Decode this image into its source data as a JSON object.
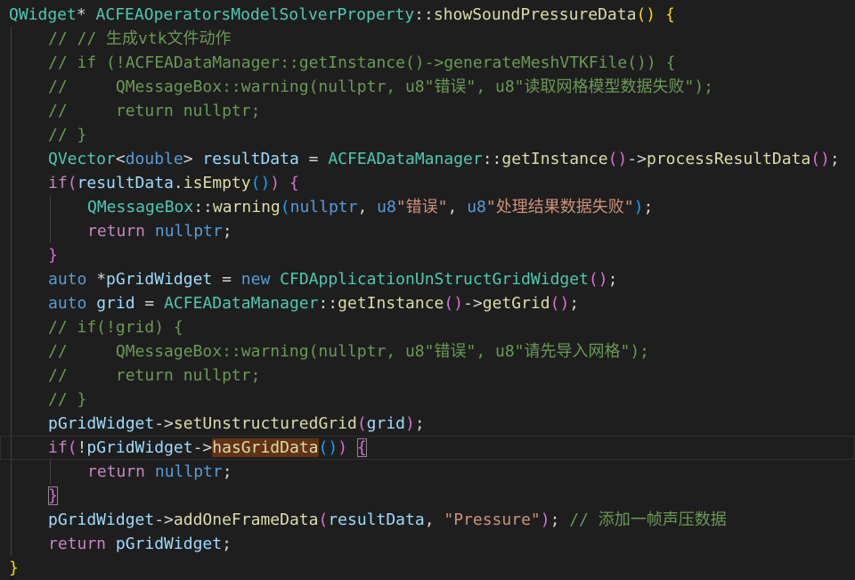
{
  "editor": {
    "lines": [
      {
        "indent": 0,
        "tokens": [
          [
            "QWidget",
            "t-type"
          ],
          [
            "* ",
            "t-default"
          ],
          [
            "ACFEAOperatorsModelSolverProperty",
            "t-type"
          ],
          [
            "::",
            "t-default"
          ],
          [
            "showSoundPressureData",
            "t-func"
          ],
          [
            "()",
            "t-b1"
          ],
          [
            " ",
            "t-default"
          ],
          [
            "{",
            "t-b1"
          ]
        ]
      },
      {
        "indent": 1,
        "tokens": [
          [
            "// // 生成vtk文件动作",
            "t-comment"
          ]
        ]
      },
      {
        "indent": 1,
        "tokens": [
          [
            "// if (!ACFEADataManager::getInstance()->generateMeshVTKFile()) {",
            "t-comment"
          ]
        ]
      },
      {
        "indent": 1,
        "tokens": [
          [
            "//     QMessageBox::warning(nullptr, u8\"错误\", u8\"读取网格模型数据失败\");",
            "t-comment"
          ]
        ]
      },
      {
        "indent": 1,
        "tokens": [
          [
            "//     return nullptr;",
            "t-comment"
          ]
        ]
      },
      {
        "indent": 1,
        "tokens": [
          [
            "// }",
            "t-comment"
          ]
        ]
      },
      {
        "indent": 1,
        "tokens": [
          [
            "QVector",
            "t-type"
          ],
          [
            "<",
            "t-default"
          ],
          [
            "double",
            "t-keyword"
          ],
          [
            "> ",
            "t-default"
          ],
          [
            "resultData",
            "t-var"
          ],
          [
            " = ",
            "t-default"
          ],
          [
            "ACFEADataManager",
            "t-type"
          ],
          [
            "::",
            "t-default"
          ],
          [
            "getInstance",
            "t-func"
          ],
          [
            "()",
            "t-b2"
          ],
          [
            "->",
            "t-default"
          ],
          [
            "processResultData",
            "t-func"
          ],
          [
            "()",
            "t-b2"
          ],
          [
            ";",
            "t-default"
          ]
        ]
      },
      {
        "indent": 1,
        "tokens": [
          [
            "if",
            "t-control"
          ],
          [
            "(",
            "t-b2"
          ],
          [
            "resultData",
            "t-var"
          ],
          [
            ".",
            "t-default"
          ],
          [
            "isEmpty",
            "t-func"
          ],
          [
            "()",
            "t-b3"
          ],
          [
            ")",
            "t-b2"
          ],
          [
            " ",
            "t-default"
          ],
          [
            "{",
            "t-b2"
          ]
        ]
      },
      {
        "indent": 2,
        "tokens": [
          [
            "QMessageBox",
            "t-type"
          ],
          [
            "::",
            "t-default"
          ],
          [
            "warning",
            "t-func"
          ],
          [
            "(",
            "t-b3"
          ],
          [
            "nullptr",
            "t-keyword"
          ],
          [
            ", ",
            "t-default"
          ],
          [
            "u8",
            "t-keyword"
          ],
          [
            "\"错误\"",
            "t-string"
          ],
          [
            ", ",
            "t-default"
          ],
          [
            "u8",
            "t-keyword"
          ],
          [
            "\"处理结果数据失败\"",
            "t-string"
          ],
          [
            ")",
            "t-b3"
          ],
          [
            ";",
            "t-default"
          ]
        ]
      },
      {
        "indent": 2,
        "tokens": [
          [
            "return",
            "t-control"
          ],
          [
            " ",
            "t-default"
          ],
          [
            "nullptr",
            "t-keyword"
          ],
          [
            ";",
            "t-default"
          ]
        ]
      },
      {
        "indent": 1,
        "tokens": [
          [
            "}",
            "t-b2"
          ]
        ]
      },
      {
        "indent": 1,
        "tokens": [
          [
            "auto",
            "t-keyword"
          ],
          [
            " *",
            "t-default"
          ],
          [
            "pGridWidget",
            "t-var"
          ],
          [
            " = ",
            "t-default"
          ],
          [
            "new",
            "t-keyword"
          ],
          [
            " ",
            "t-default"
          ],
          [
            "CFDApplicationUnStructGridWidget",
            "t-type"
          ],
          [
            "()",
            "t-b2"
          ],
          [
            ";",
            "t-default"
          ]
        ]
      },
      {
        "indent": 1,
        "tokens": [
          [
            "auto",
            "t-keyword"
          ],
          [
            " ",
            "t-default"
          ],
          [
            "grid",
            "t-var"
          ],
          [
            " = ",
            "t-default"
          ],
          [
            "ACFEADataManager",
            "t-type"
          ],
          [
            "::",
            "t-default"
          ],
          [
            "getInstance",
            "t-func"
          ],
          [
            "()",
            "t-b2"
          ],
          [
            "->",
            "t-default"
          ],
          [
            "getGrid",
            "t-func"
          ],
          [
            "()",
            "t-b2"
          ],
          [
            ";",
            "t-default"
          ]
        ]
      },
      {
        "indent": 1,
        "tokens": [
          [
            "// if(!grid) {",
            "t-comment"
          ]
        ]
      },
      {
        "indent": 1,
        "tokens": [
          [
            "//     QMessageBox::warning(nullptr, u8\"错误\", u8\"请先导入网格\");",
            "t-comment"
          ]
        ]
      },
      {
        "indent": 1,
        "tokens": [
          [
            "//     return nullptr;",
            "t-comment"
          ]
        ]
      },
      {
        "indent": 1,
        "tokens": [
          [
            "// }",
            "t-comment"
          ]
        ]
      },
      {
        "indent": 1,
        "tokens": [
          [
            "pGridWidget",
            "t-var"
          ],
          [
            "->",
            "t-default"
          ],
          [
            "setUnstructuredGrid",
            "t-func"
          ],
          [
            "(",
            "t-b2"
          ],
          [
            "grid",
            "t-var"
          ],
          [
            ")",
            "t-b2"
          ],
          [
            ";",
            "t-default"
          ]
        ]
      },
      {
        "indent": 1,
        "current": true,
        "tokens": [
          [
            "if",
            "t-control"
          ],
          [
            "(",
            "t-b2"
          ],
          [
            "!",
            "t-default"
          ],
          [
            "pGridWidget",
            "t-var"
          ],
          [
            "->",
            "t-default"
          ],
          [
            "hasGridData",
            "t-func",
            "hl-word"
          ],
          [
            "()",
            "t-b3"
          ],
          [
            ")",
            "t-b2"
          ],
          [
            " ",
            "t-default"
          ],
          [
            "{",
            "t-b2",
            "hl-match"
          ]
        ]
      },
      {
        "indent": 2,
        "tokens": [
          [
            "return",
            "t-control"
          ],
          [
            " ",
            "t-default"
          ],
          [
            "nullptr",
            "t-keyword"
          ],
          [
            ";",
            "t-default"
          ]
        ]
      },
      {
        "indent": 1,
        "tokens": [
          [
            "}",
            "t-b2",
            "hl-match"
          ]
        ]
      },
      {
        "indent": 1,
        "tokens": [
          [
            "pGridWidget",
            "t-var"
          ],
          [
            "->",
            "t-default"
          ],
          [
            "addOneFrameData",
            "t-func"
          ],
          [
            "(",
            "t-b2"
          ],
          [
            "resultData",
            "t-var"
          ],
          [
            ", ",
            "t-default"
          ],
          [
            "\"Pressure\"",
            "t-string"
          ],
          [
            ")",
            "t-b2"
          ],
          [
            "; ",
            "t-default"
          ],
          [
            "// 添加一帧声压数据",
            "t-comment"
          ]
        ]
      },
      {
        "indent": 1,
        "tokens": [
          [
            "return",
            "t-control"
          ],
          [
            " ",
            "t-default"
          ],
          [
            "pGridWidget",
            "t-var"
          ],
          [
            ";",
            "t-default"
          ]
        ]
      },
      {
        "indent": 0,
        "tokens": [
          [
            "}",
            "t-b1"
          ]
        ]
      }
    ]
  }
}
